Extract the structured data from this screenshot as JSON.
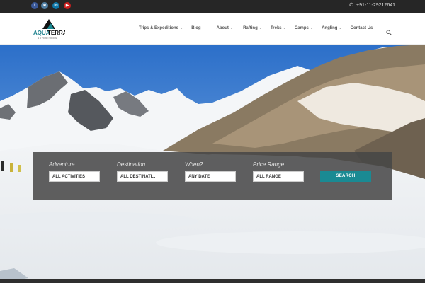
{
  "topbar": {
    "social": [
      {
        "name": "facebook-icon",
        "glyph": "f",
        "color": "#3b5998"
      },
      {
        "name": "instagram-icon",
        "glyph": "◙",
        "color": "#517fa4"
      },
      {
        "name": "linkedin-icon",
        "glyph": "in",
        "color": "#0e76a8"
      },
      {
        "name": "youtube-icon",
        "glyph": "▶",
        "color": "#cd201f"
      }
    ],
    "phone": "+91-11-29212641"
  },
  "header": {
    "logo_text_aqua": "AQUA",
    "logo_text_terra": "TERRA",
    "logo_sub": "ADVENTURES",
    "nav": [
      {
        "label": "Trips & Expeditions",
        "dropdown": true
      },
      {
        "label": "Blog",
        "dropdown": false
      },
      {
        "label": "About",
        "dropdown": true
      },
      {
        "label": "Rafting",
        "dropdown": true
      },
      {
        "label": "Treks",
        "dropdown": true
      },
      {
        "label": "Camps",
        "dropdown": true
      },
      {
        "label": "Angling",
        "dropdown": true
      },
      {
        "label": "Contact Us",
        "dropdown": false
      }
    ]
  },
  "search_panel": {
    "fields": [
      {
        "label": "Adventure",
        "value": "ALL ACTIVITIES"
      },
      {
        "label": "Destination",
        "value": "ALL DESTINATI..."
      },
      {
        "label": "When?",
        "value": "ANY DATE"
      },
      {
        "label": "Price Range",
        "value": "ALL RANGE"
      }
    ],
    "button_label": "SEARCH"
  },
  "colors": {
    "accent": "#1a8a93",
    "topbar_bg": "#262626",
    "panel_bg": "#464646"
  }
}
